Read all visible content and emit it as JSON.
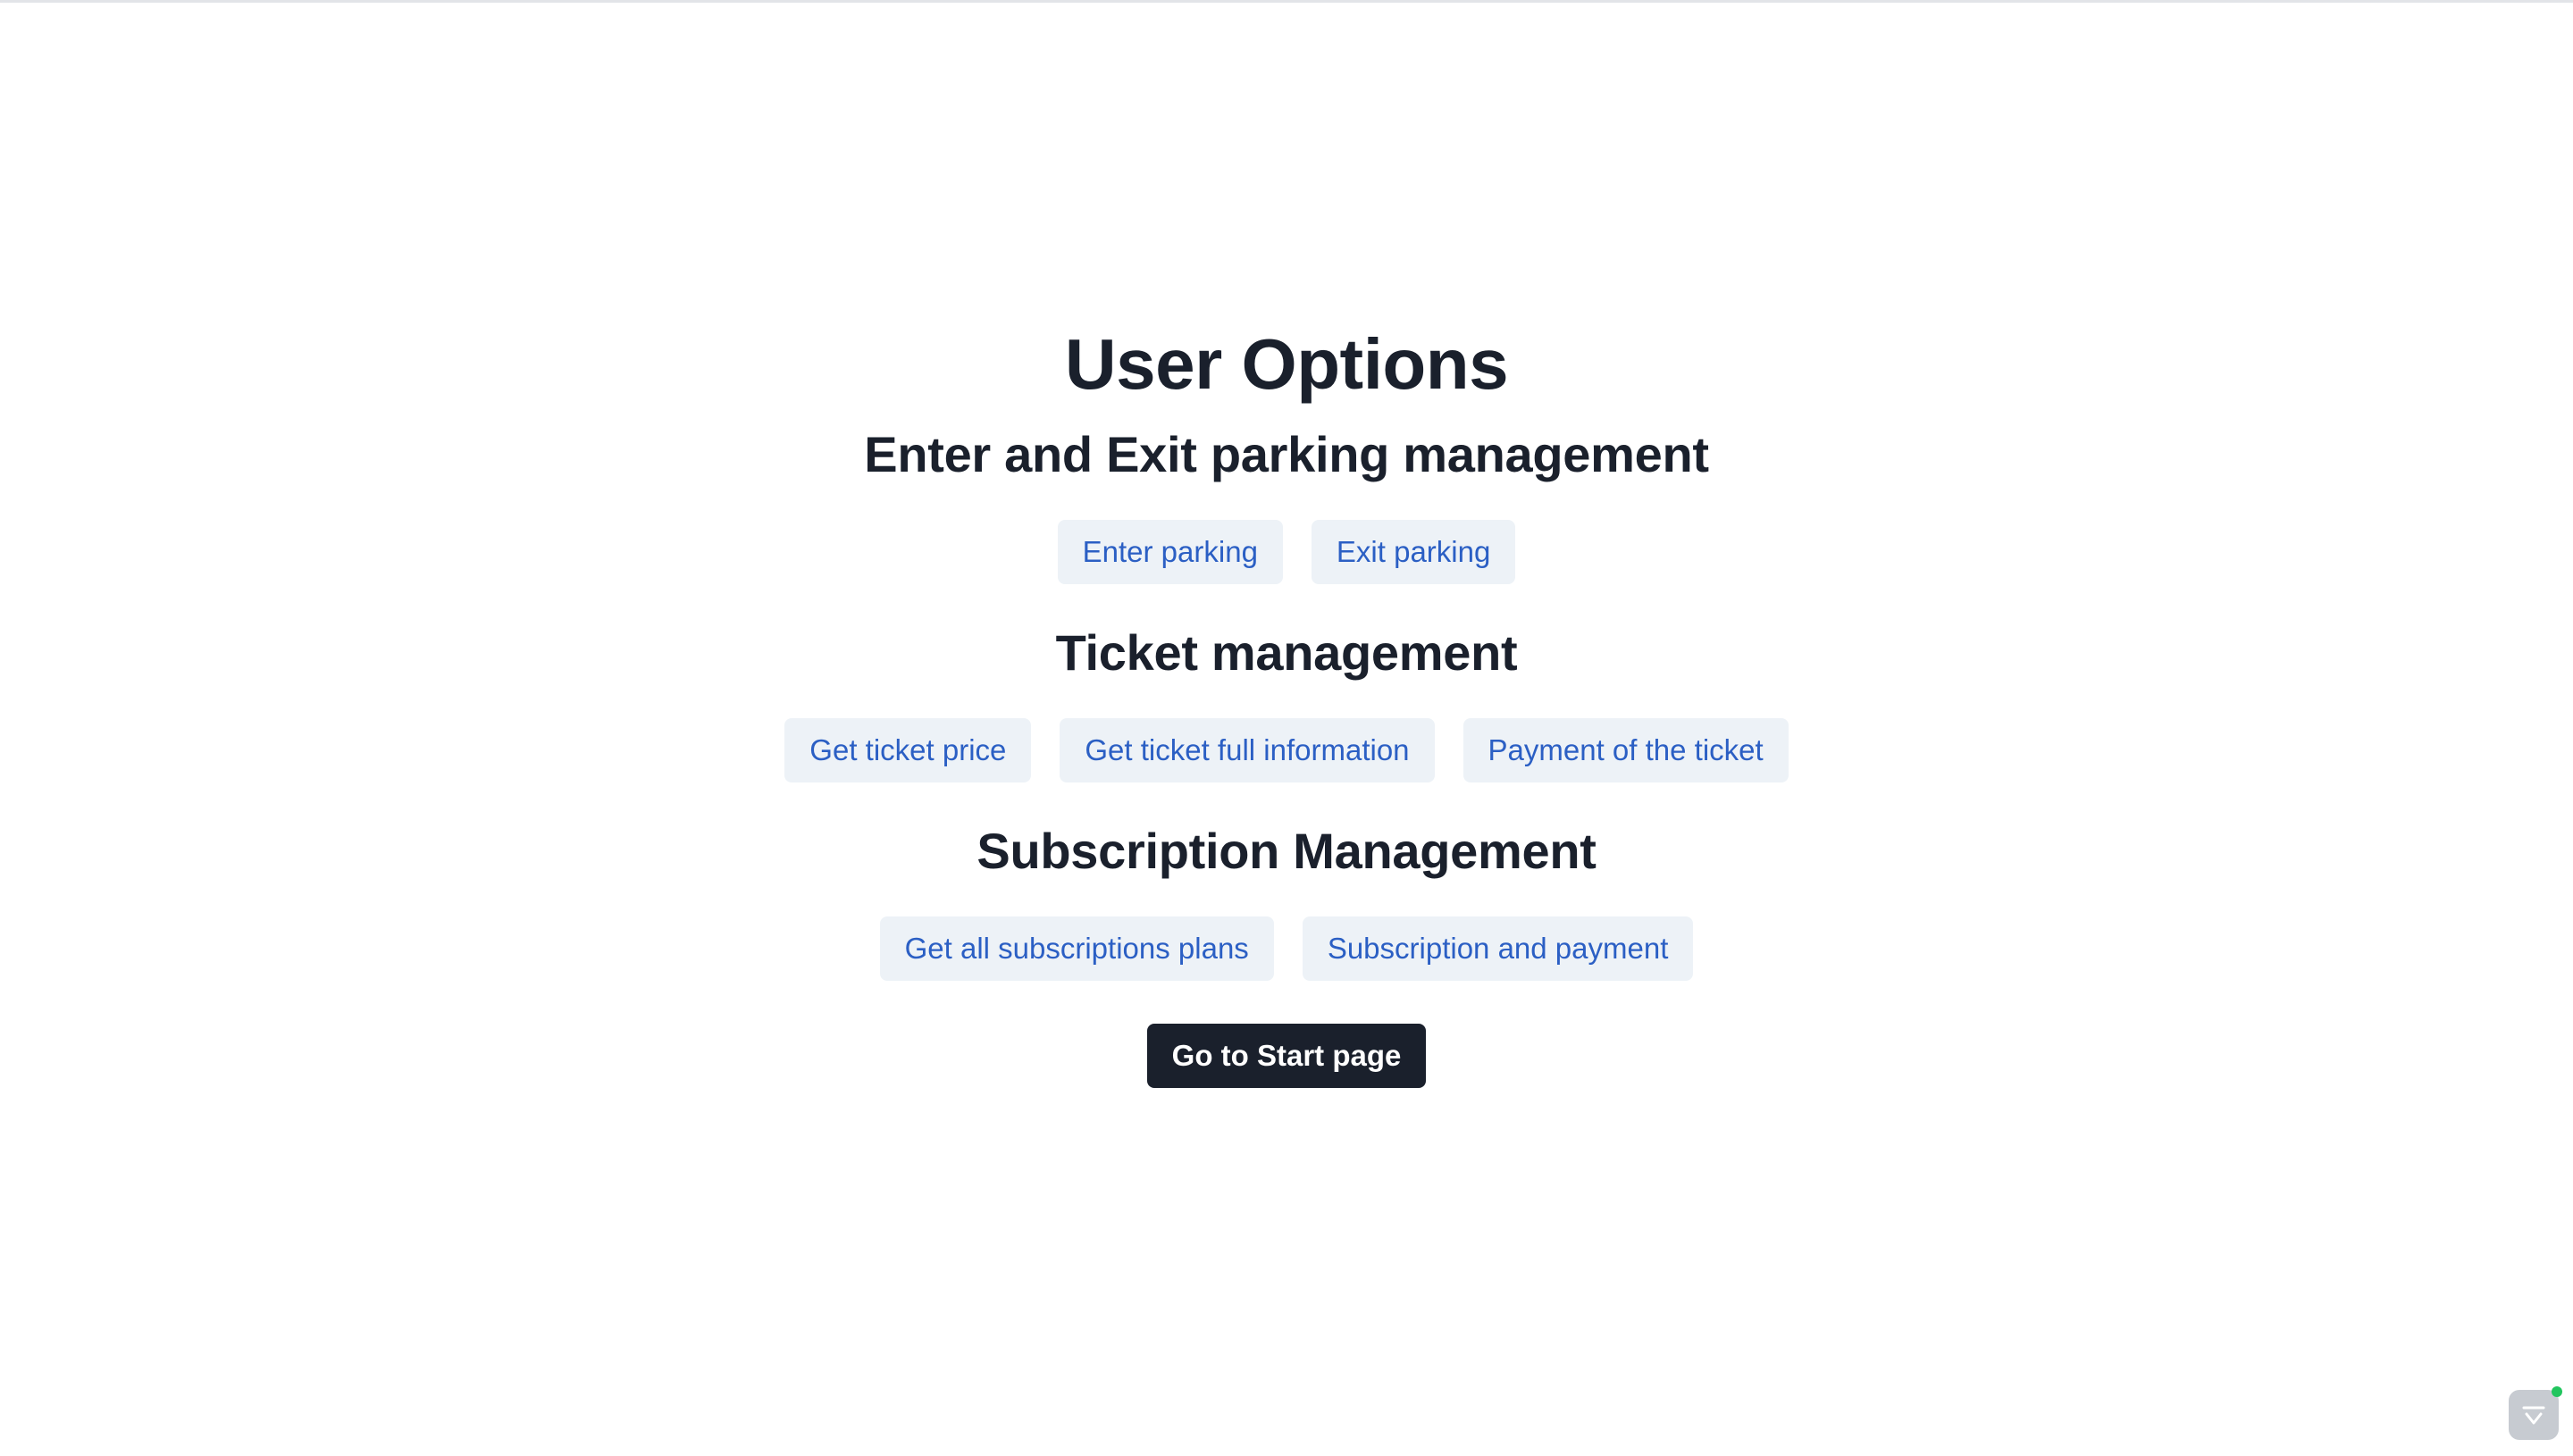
{
  "page": {
    "title": "User Options"
  },
  "sections": [
    {
      "title": "Enter and Exit parking management",
      "buttons": [
        "Enter parking",
        "Exit parking"
      ]
    },
    {
      "title": "Ticket management",
      "buttons": [
        "Get ticket price",
        "Get ticket full information",
        "Payment of the ticket"
      ]
    },
    {
      "title": "Subscription Management",
      "buttons": [
        "Get all subscriptions plans",
        "Subscription and payment"
      ]
    }
  ],
  "footer": {
    "start_label": "Go to Start page"
  },
  "widget": {
    "icon": "checklist-icon",
    "status_color": "#22c55e"
  },
  "colors": {
    "heading": "#1a202c",
    "option_text": "#2b5fc4",
    "option_bg": "#edf2f7",
    "primary_bg": "#1a202c"
  }
}
